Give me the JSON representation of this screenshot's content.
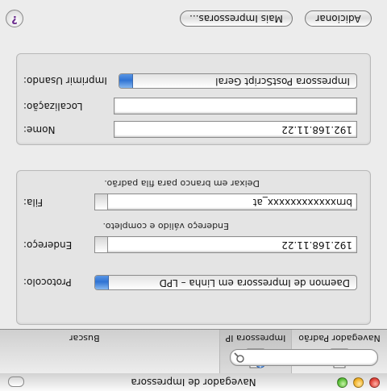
{
  "window": {
    "title": "Navegador de Impressora"
  },
  "toolbar": {
    "items": [
      {
        "label": "Navegador Padrão",
        "icon": "printer-icon"
      },
      {
        "label": "Impressora IP",
        "icon": "ip-printer-icon"
      }
    ],
    "search": {
      "label": "Buscar",
      "placeholder": ""
    }
  },
  "connection": {
    "protocol_label": "Protocolo:",
    "protocol_value": "Daemon de Impressora em Linha – LPD",
    "address_label": "Endereço:",
    "address_value": "192.168.11.22",
    "address_hint": "Endereço válido e completo.",
    "queue_label": "Fila:",
    "queue_value": "brnxxxxxxxxxxxx_at",
    "queue_hint": "Deixar em branco para fila padrão."
  },
  "details": {
    "name_label": "Nome:",
    "name_value": "192.168.11.22",
    "location_label": "Localização:",
    "location_value": "",
    "print_using_label": "Imprimir Usando:",
    "print_using_value": "Impressora PostScript Geral"
  },
  "buttons": {
    "more_printers": "Mais Impressoras...",
    "add": "Adicionar",
    "help": "?"
  },
  "colors": {
    "accent": "#2f73d4"
  }
}
